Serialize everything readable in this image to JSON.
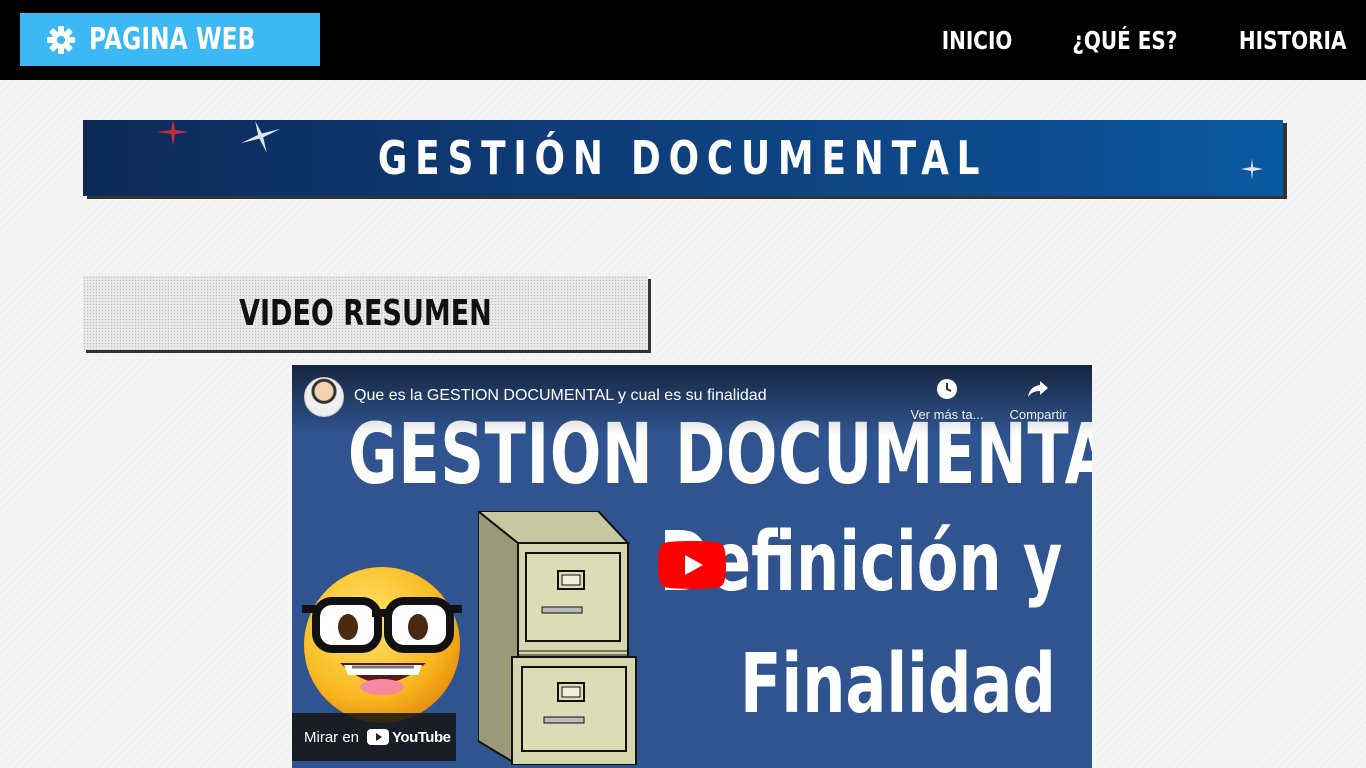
{
  "header": {
    "logo_text": "PAGINA WEB",
    "logo_icon": "gear-icon",
    "nav": [
      {
        "label": "INICIO"
      },
      {
        "label": "¿QUÉ ES?"
      },
      {
        "label": "HISTORIA"
      }
    ],
    "colors": {
      "bar": "#000000",
      "logo_bg": "#3cb8f5"
    }
  },
  "banner": {
    "title": "GESTIÓN DOCUMENTAL"
  },
  "section": {
    "heading": "VIDEO RESUMEN"
  },
  "video": {
    "title": "Que es la GESTION DOCUMENTAL y cual es su finalidad",
    "watch_later_label": "Ver más ta...",
    "share_label": "Compartir",
    "thumbnail_heading": "GESTION DOCUMENTAL",
    "thumbnail_line1": "Definición y",
    "thumbnail_line2": "Finalidad",
    "watch_on_label": "Mirar en",
    "youtube_word": "YouTube",
    "colors": {
      "background": "#30548f",
      "play": "#ff0000"
    }
  }
}
